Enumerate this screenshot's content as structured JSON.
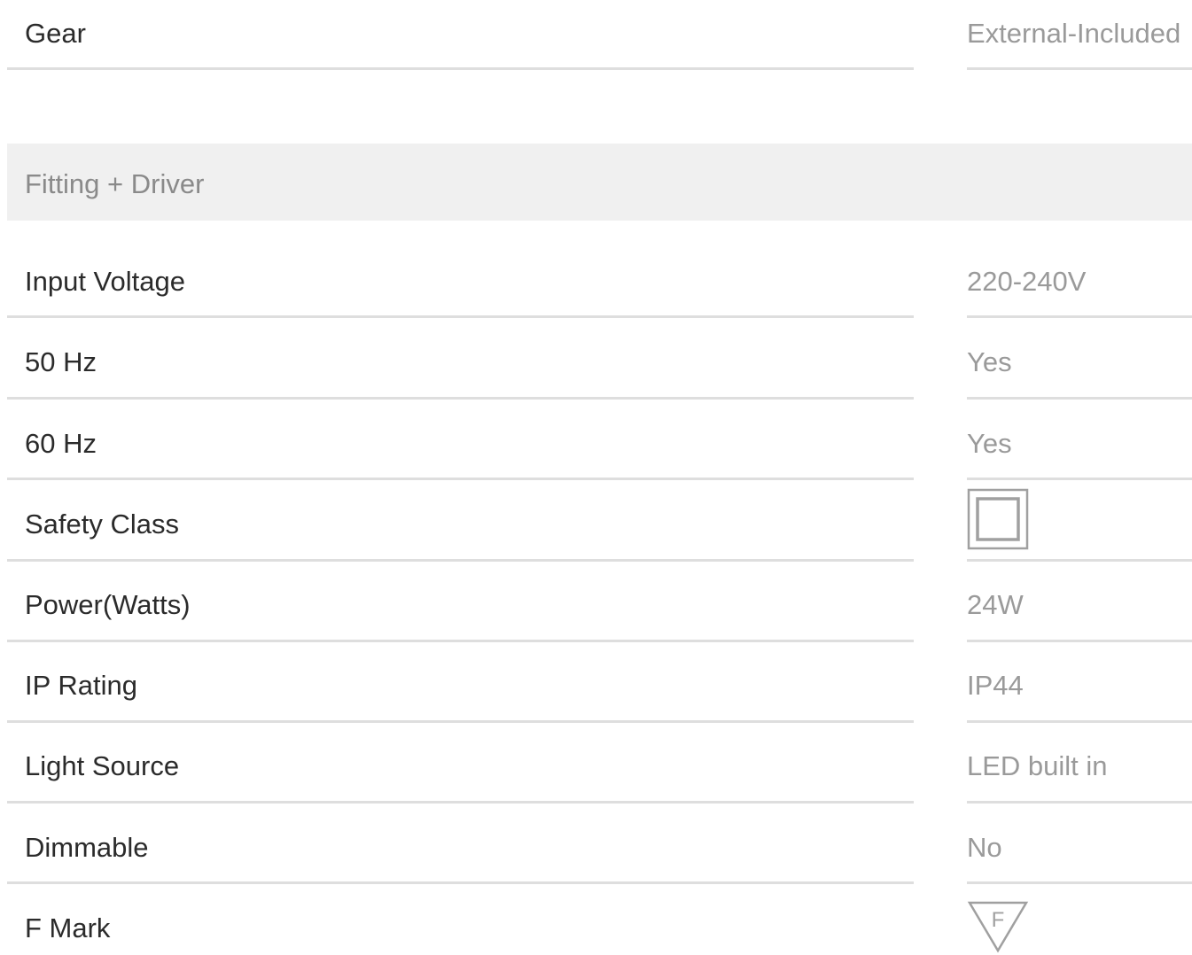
{
  "header_row": {
    "label": "Gear",
    "value": "External-Included"
  },
  "section": {
    "title": "Fitting + Driver"
  },
  "specs": [
    {
      "label": "Input Voltage",
      "value": "220-240V"
    },
    {
      "label": "50 Hz",
      "value": "Yes"
    },
    {
      "label": "60 Hz",
      "value": "Yes"
    },
    {
      "label": "Safety Class",
      "icon": "class-ii-double-square-icon"
    },
    {
      "label": "Power(Watts)",
      "value": "24W"
    },
    {
      "label": "IP Rating",
      "value": "IP44"
    },
    {
      "label": "Light Source",
      "value": "LED built in"
    },
    {
      "label": "Dimmable",
      "value": "No"
    },
    {
      "label": "F Mark",
      "icon": "f-mark-triangle-icon",
      "icon_letter": "F"
    }
  ],
  "colors": {
    "label_text": "#2b2b2b",
    "value_text": "#9a9a9a",
    "rule": "#dedede",
    "section_bg": "#f0f0f0",
    "icon_stroke": "#a0a0a0"
  }
}
